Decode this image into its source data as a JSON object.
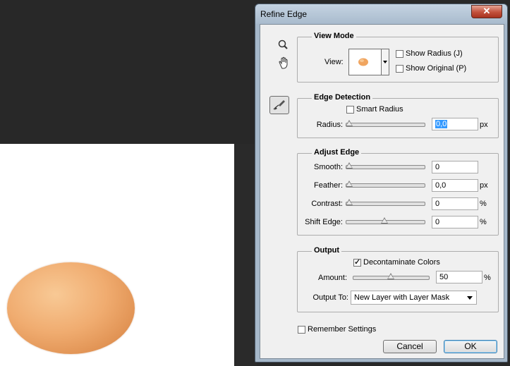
{
  "dialog": {
    "title": "Refine Edge",
    "close_symbol": "✕"
  },
  "view_mode": {
    "legend": "View Mode",
    "view_label": "View:",
    "show_radius": "Show Radius (J)",
    "show_original": "Show Original (P)"
  },
  "edge_detection": {
    "legend": "Edge Detection",
    "smart_radius": "Smart Radius",
    "radius_label": "Radius:",
    "radius_value": "0,0",
    "radius_unit": "px"
  },
  "adjust_edge": {
    "legend": "Adjust Edge",
    "smooth_label": "Smooth:",
    "smooth_value": "0",
    "feather_label": "Feather:",
    "feather_value": "0,0",
    "feather_unit": "px",
    "contrast_label": "Contrast:",
    "contrast_value": "0",
    "contrast_unit": "%",
    "shift_label": "Shift Edge:",
    "shift_value": "0",
    "shift_unit": "%"
  },
  "output": {
    "legend": "Output",
    "decontaminate": "Decontaminate Colors",
    "decontaminate_checked": true,
    "amount_label": "Amount:",
    "amount_value": "50",
    "amount_unit": "%",
    "output_to_label": "Output To:",
    "output_to_value": "New Layer with Layer Mask"
  },
  "remember": "Remember Settings",
  "buttons": {
    "cancel": "Cancel",
    "ok": "OK"
  },
  "icons": {
    "zoom": "zoom-tool-icon",
    "hand": "hand-tool-icon",
    "refine": "refine-radius-tool-icon"
  }
}
